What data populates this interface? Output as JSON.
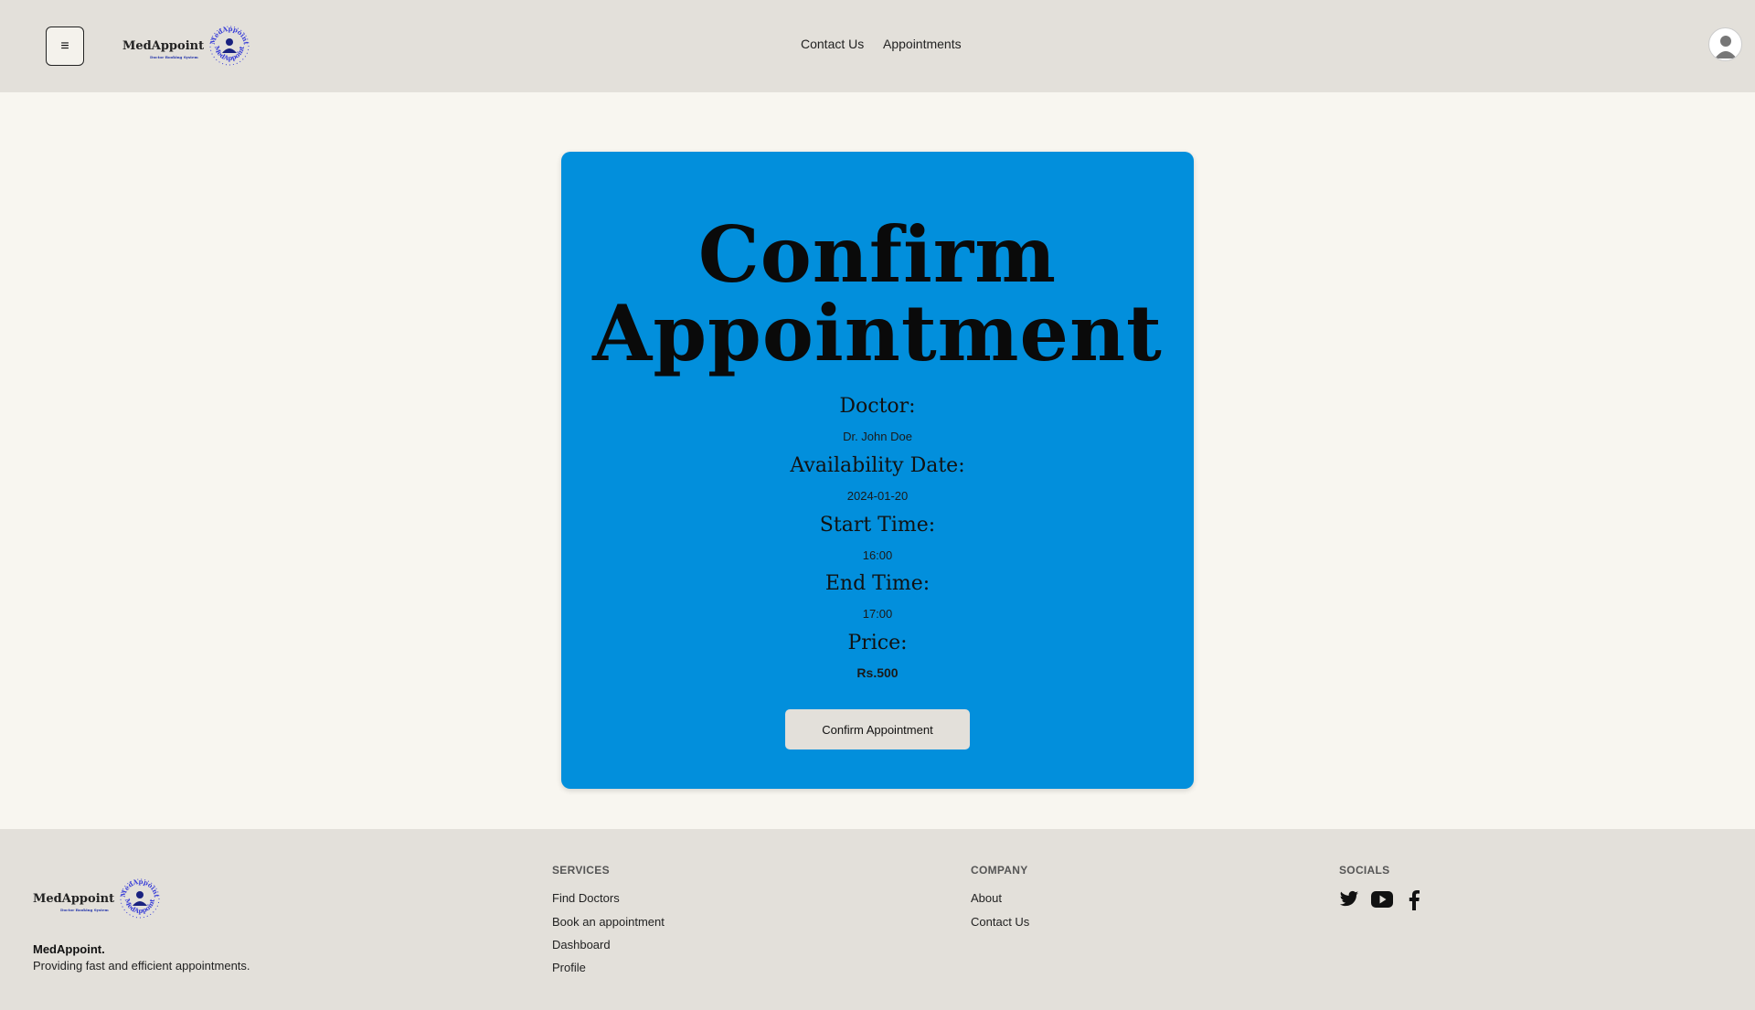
{
  "header": {
    "menu_icon": "hamburger-icon",
    "menu_glyph": "≡",
    "logo": {
      "name": "MedAppoint",
      "subtitle": "Doctor Booking System",
      "ring_text": "MedAppoint"
    },
    "nav": {
      "contact": "Contact Us",
      "appointments": "Appointments"
    },
    "avatar_icon": "user-avatar-icon"
  },
  "card": {
    "title_line1": "Confirm",
    "title_line2": "Appointment",
    "doctor_label": "Doctor:",
    "doctor_value": "Dr. John Doe",
    "date_label": "Availability Date:",
    "date_value": "2024-01-20",
    "start_label": "Start Time:",
    "start_value": "16:00",
    "end_label": "End Time:",
    "end_value": "17:00",
    "price_label": "Price:",
    "price_value": "Rs.500",
    "confirm_button": "Confirm Appointment",
    "background_color": "#028fdc"
  },
  "footer": {
    "brand": "MedAppoint.",
    "tagline": "Providing fast and efficient appointments.",
    "services": {
      "heading": "SERVICES",
      "links": [
        "Find Doctors",
        "Book an appointment",
        "Dashboard",
        "Profile"
      ]
    },
    "company": {
      "heading": "COMPANY",
      "links": [
        "About",
        "Contact Us"
      ]
    },
    "socials": {
      "heading": "SOCIALS",
      "icons": [
        "twitter-icon",
        "youtube-icon",
        "facebook-icon"
      ]
    }
  },
  "colors": {
    "header_bg": "#e3e0da",
    "page_bg": "#f8f6f0",
    "logo_accent": "#3a3fd8"
  }
}
